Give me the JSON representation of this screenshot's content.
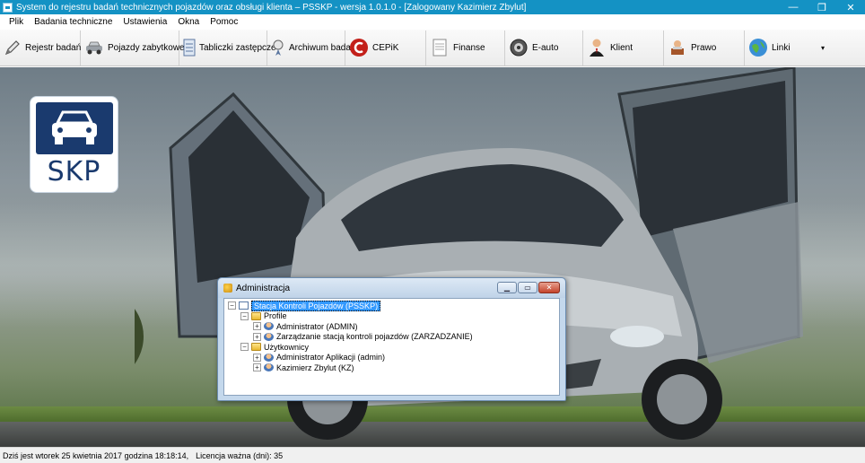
{
  "window": {
    "title": "System do rejestru badań technicznych pojazdów oraz obsługi klienta – PSSKP - wersja 1.0.1.0 - [Zalogowany Kazimierz Zbylut]",
    "minimize": "—",
    "restore": "❐",
    "close": "✕"
  },
  "menu": [
    "Plik",
    "Badania techniczne",
    "Ustawienia",
    "Okna",
    "Pomoc"
  ],
  "toolbar": [
    {
      "label": "Rejestr badań",
      "icon": "pen-icon"
    },
    {
      "label": "Pojazdy zabytkowe",
      "icon": "vintage-car-icon"
    },
    {
      "label": "Tabliczki zastępcze",
      "icon": "plate-icon"
    },
    {
      "label": "Archiwum badań",
      "icon": "archive-icon"
    },
    {
      "label": "CEPiK",
      "icon": "cepik-icon"
    },
    {
      "label": "Finanse",
      "icon": "document-icon"
    },
    {
      "label": "E-auto",
      "icon": "eauto-icon"
    },
    {
      "label": "Klient",
      "icon": "client-icon"
    },
    {
      "label": "Prawo",
      "icon": "law-icon"
    },
    {
      "label": "Linki",
      "icon": "globe-icon"
    }
  ],
  "toolbar_dropdown": "▾",
  "logo": {
    "text": "SKP"
  },
  "dialog": {
    "title": "Administracja",
    "tree": [
      {
        "label": "Stacja Kontroli Pojazdów (PSSKP)",
        "level": 0,
        "expander": "−",
        "icon": "monitor",
        "selected": true
      },
      {
        "label": "Profile",
        "level": 1,
        "expander": "−",
        "icon": "folder"
      },
      {
        "label": "Administrator (ADMIN)",
        "level": 2,
        "expander": "+",
        "icon": "user"
      },
      {
        "label": "Zarządzanie stacją kontroli pojazdów (ZARZADZANIE)",
        "level": 2,
        "expander": "+",
        "icon": "user"
      },
      {
        "label": "Użytkownicy",
        "level": 1,
        "expander": "−",
        "icon": "folder"
      },
      {
        "label": "Administrator Aplikacji (admin)",
        "level": 2,
        "expander": "+",
        "icon": "user"
      },
      {
        "label": "Kazimierz Zbylut (KZ)",
        "level": 2,
        "expander": "+",
        "icon": "user"
      }
    ]
  },
  "status": {
    "date": "Dziś jest wtorek 25 kwietnia 2017 godzina 18:18:14,",
    "license": "Licencja ważna (dni): 35"
  }
}
